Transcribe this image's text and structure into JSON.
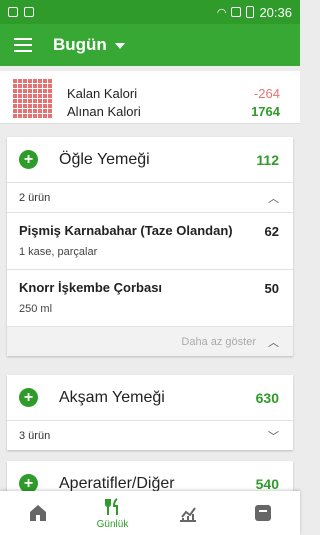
{
  "app_bar": {
    "title": "Bugün"
  },
  "status_bar": {
    "time": "20:36"
  },
  "summary": {
    "remaining_label": "Kalan Kalori",
    "remaining_value": "-264",
    "consumed_label": "Alınan Kalori",
    "consumed_value": "1764"
  },
  "meals": [
    {
      "title": "Öğle Yemeği",
      "total": "112",
      "count_label": "2 ürün",
      "items": [
        {
          "name": "Pişmiş Karnabahar (Taze Olandan)",
          "serving": "1 kase, parçalar",
          "calories": "62"
        },
        {
          "name": "Knorr İşkembe Çorbası",
          "serving": "250 ml",
          "calories": "50"
        }
      ],
      "show_less": "Daha az göster"
    },
    {
      "title": "Akşam Yemeği",
      "total": "630",
      "count_label": "3 ürün"
    },
    {
      "title": "Aperatifler/Diğer",
      "total": "540"
    }
  ],
  "bottom_nav": [
    {
      "label": "",
      "icon": "home-icon"
    },
    {
      "label": "Günlük",
      "icon": "cutlery-icon"
    },
    {
      "label": "",
      "icon": "chart-icon"
    },
    {
      "label": "",
      "icon": "profile-icon"
    }
  ],
  "colors": {
    "primary": "#38a834",
    "status": "#2f9b2a",
    "negative": "#e57373"
  }
}
